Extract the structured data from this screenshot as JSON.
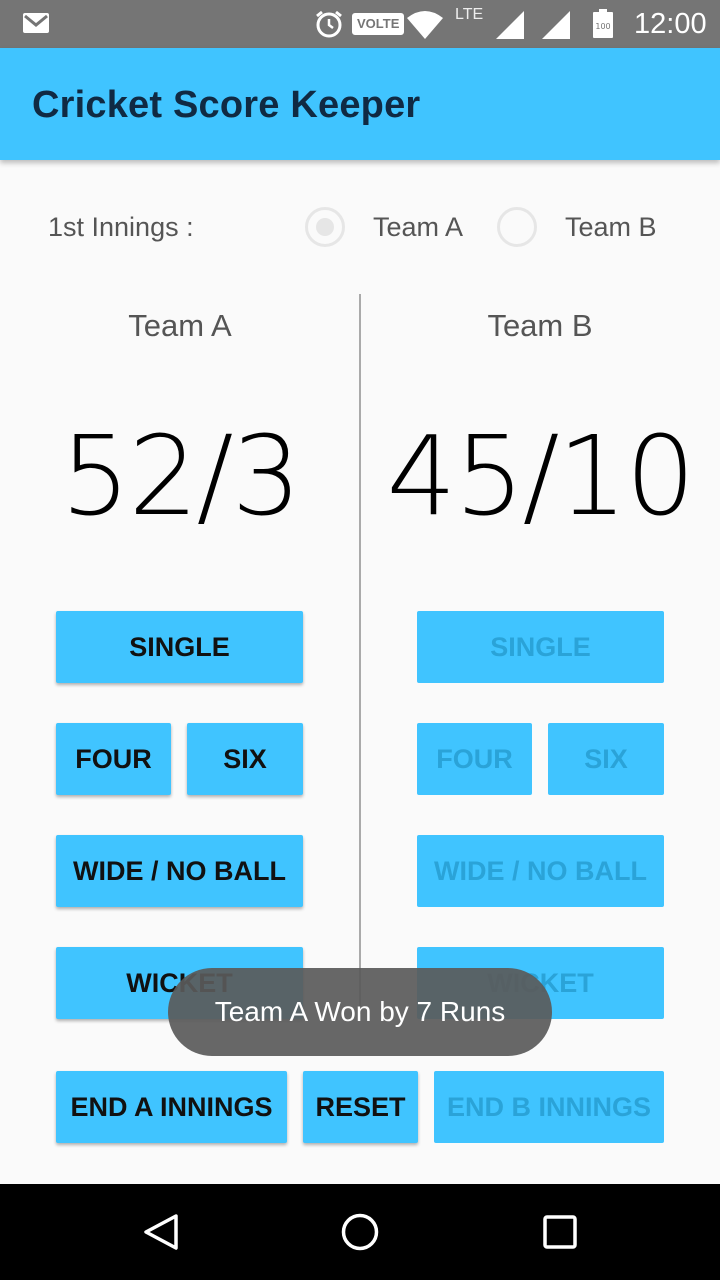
{
  "status_bar": {
    "volte": "VOLTE",
    "lte": "LTE",
    "battery": "100",
    "time": "12:00",
    "icons": [
      "gmail-icon",
      "alarm-icon",
      "wifi-icon",
      "signal-icon",
      "battery-icon"
    ]
  },
  "app_bar": {
    "title": "Cricket Score Keeper"
  },
  "innings": {
    "label": "1st Innings :",
    "options": [
      {
        "label": "Team A",
        "selected": true
      },
      {
        "label": "Team B",
        "selected": false
      }
    ]
  },
  "team_a": {
    "name": "Team A",
    "score": "52/3",
    "buttons": {
      "single": "SINGLE",
      "four": "FOUR",
      "six": "SIX",
      "wide": "WIDE / NO BALL",
      "wicket": "WICKET"
    },
    "enabled": true
  },
  "team_b": {
    "name": "Team B",
    "score": "45/10",
    "buttons": {
      "single": "SINGLE",
      "four": "FOUR",
      "six": "SIX",
      "wide": "WIDE / NO BALL",
      "wicket": "WICKET"
    },
    "enabled": false
  },
  "bottom_buttons": {
    "end_a": "END A INNINGS",
    "reset": "RESET",
    "end_b": "END B INNINGS"
  },
  "toast": "Team A Won by 7 Runs",
  "colors": {
    "accent": "#40c4ff",
    "status_bar": "#757575",
    "title": "#102a43"
  },
  "nav_bar": {
    "icons": [
      "back-icon",
      "home-icon",
      "recents-icon"
    ]
  }
}
